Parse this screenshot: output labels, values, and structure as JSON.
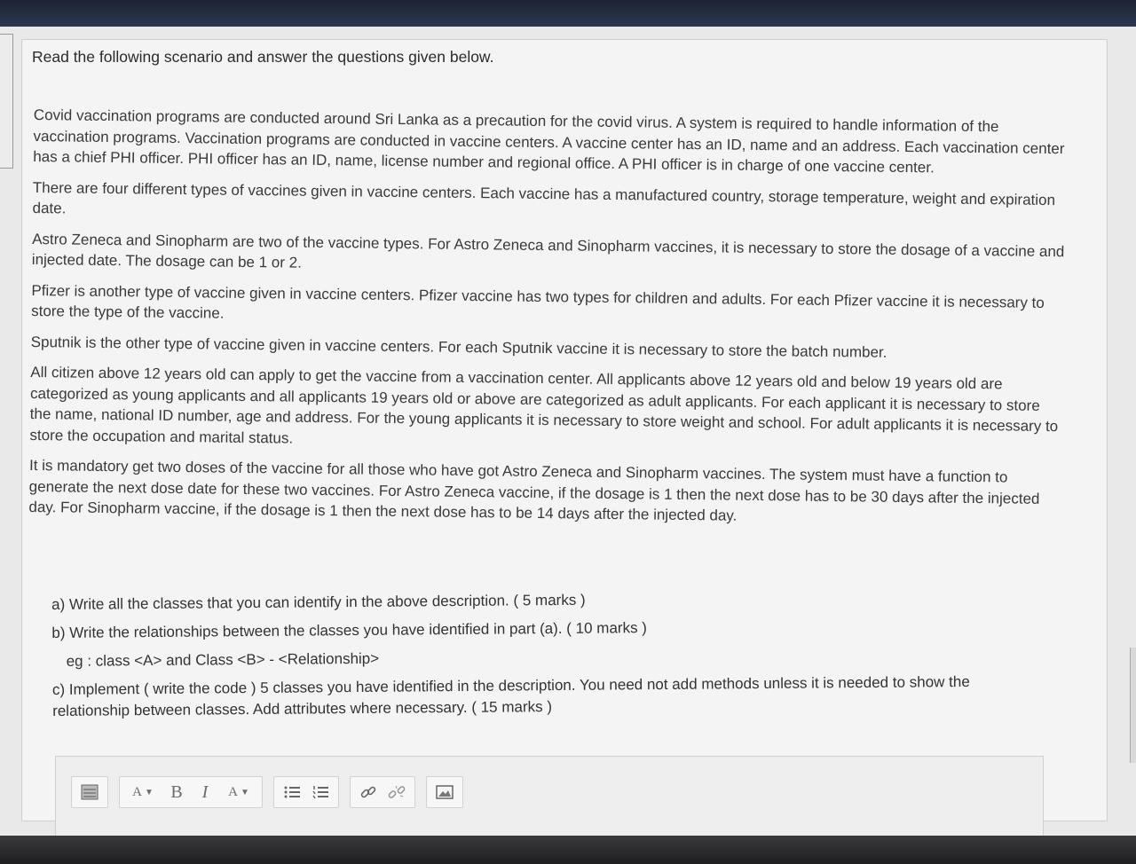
{
  "scenario": {
    "heading": "Read the following scenario and answer the questions given below.",
    "paragraphs": [
      "Covid vaccination programs are conducted around Sri Lanka as a precaution for the covid virus. A system is required to handle information of the vaccination programs. Vaccination programs are conducted in vaccine centers. A vaccine center has an ID, name and an address. Each vaccination center has a chief PHI officer. PHI officer has an ID, name, license number and regional office. A PHI officer is in charge of one vaccine center.",
      "There are four different types of vaccines given in vaccine centers. Each vaccine has a manufactured country, storage temperature, weight and expiration date.",
      "Astro Zeneca and Sinopharm are two of the vaccine types. For Astro Zeneca and Sinopharm vaccines, it is necessary to store the dosage of a vaccine and injected date. The dosage can be 1 or 2.",
      "Pfizer is another type of vaccine given in vaccine centers. Pfizer vaccine has two types for children and adults. For each Pfizer vaccine it is necessary to store the type of the vaccine.",
      "Sputnik is the other type of vaccine given in vaccine centers. For each Sputnik vaccine it is necessary to store the batch number.",
      "All citizen above 12 years old can apply to get the vaccine from a vaccination center. All applicants above 12 years old and below 19 years old are categorized as young applicants and all applicants 19 years old or above are categorized as adult applicants. For each applicant it is necessary to store the name, national ID number, age and address. For the young applicants it is necessary to store weight and school. For adult applicants it is necessary to store the occupation and marital status.",
      "It is mandatory get two doses of the vaccine for all those who have got Astro Zeneca and Sinopharm vaccines. The system must have a function to generate the next dose date for these two vaccines. For Astro Zeneca vaccine, if the dosage is 1 then the next dose has to be 30 days after the injected day. For Sinopharm vaccine, if the dosage is 1 then the next dose has to be 14 days after the injected day."
    ]
  },
  "questions": {
    "a": "a) Write all the classes that you can identify in the above description. ( 5 marks )",
    "b": "b) Write the relationships between the classes you have identified in part (a). ( 10 marks )",
    "eg": "eg : class <A> and Class <B> - <Relationship>",
    "c": "c) Implement ( write the code ) 5 classes you have identified in the description. You need not add methods unless it is needed to show the relationship between classes. Add attributes where necessary. ( 15 marks )"
  },
  "toolbar": {
    "font_size_label": "A",
    "bold_label": "B",
    "italic_label": "I",
    "font_color_label": "A",
    "icons": [
      "show-more-icon",
      "font-size-icon",
      "bold-icon",
      "italic-icon",
      "font-color-icon",
      "bullet-list-icon",
      "numbered-list-icon",
      "link-icon",
      "unlink-icon",
      "image-icon"
    ]
  }
}
